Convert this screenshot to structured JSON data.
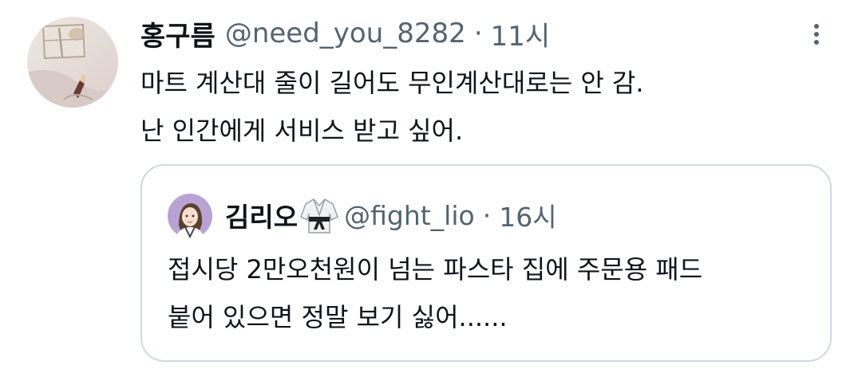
{
  "tweet": {
    "display_name": "홍구름",
    "handle": "@need_you_8282",
    "separator": "·",
    "time": "11시",
    "text_lines": [
      "마트 계산대 줄이 길어도 무인계산대로는 안 감.",
      "난 인간에게 서비스 받고 싶어."
    ],
    "more_icon": "more-vertical-icon"
  },
  "quoted_tweet": {
    "display_name": "김리오",
    "emoji": "martial-arts-uniform-emoji",
    "handle": "@fight_lio",
    "separator": "·",
    "time": "16시",
    "text_lines": [
      "접시당 2만오천원이 넘는 파스타 집에 주문용 패드",
      "붙어 있으면 정말 보기 싫어......"
    ]
  },
  "colors": {
    "primary_text": "#0f1419",
    "secondary_text": "#536471",
    "border": "#cfd9de"
  }
}
